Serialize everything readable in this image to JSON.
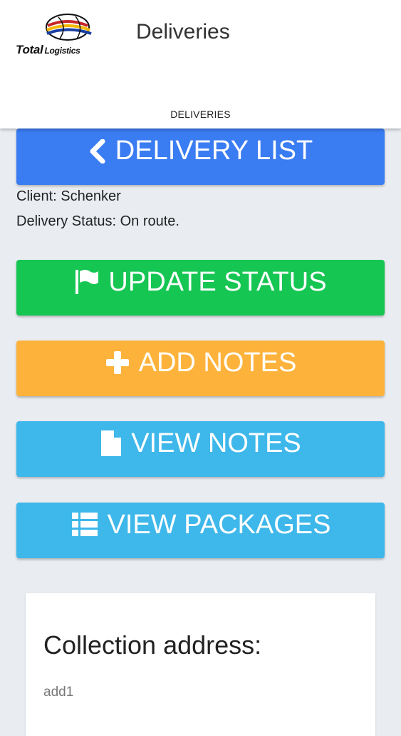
{
  "header": {
    "logo_text_main": "Total",
    "logo_text_sub": "Logistics",
    "title": "Deliveries",
    "tab": "DELIVERIES"
  },
  "buttons": {
    "delivery_list": "DELIVERY LIST",
    "update_status": "UPDATE STATUS",
    "add_notes": "ADD NOTES",
    "view_notes": "VIEW NOTES",
    "view_packages": "VIEW PACKAGES"
  },
  "delivery": {
    "client": "Client: Schenker",
    "status": "Delivery Status: On route."
  },
  "collection": {
    "heading": "Collection address:",
    "line1": "add1"
  },
  "icons": {
    "back": "chevron-left-icon",
    "flag": "flag-icon",
    "plus": "plus-icon",
    "file": "file-icon",
    "list": "list-icon"
  },
  "colors": {
    "blue": "#3a7cf2",
    "green": "#16c653",
    "orange": "#fdb33b",
    "light_blue": "#3eb7ea",
    "background": "#e9edf2"
  }
}
